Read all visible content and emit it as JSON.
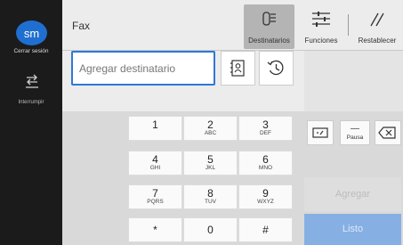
{
  "sidebar": {
    "avatar": "sm",
    "logout_label": "Cerrar sesión",
    "interrupt_label": "Interrumpir"
  },
  "header": {
    "title": "Fax",
    "destinations_label": "Destinatarios",
    "functions_label": "Funciones",
    "reset_label": "Restablecer"
  },
  "address": {
    "placeholder": "Agregar destinatario"
  },
  "keypad": [
    {
      "num": "1",
      "letters": ""
    },
    {
      "num": "2",
      "letters": "ABC"
    },
    {
      "num": "3",
      "letters": "DEF"
    },
    {
      "num": "4",
      "letters": "GHI"
    },
    {
      "num": "5",
      "letters": "JKL"
    },
    {
      "num": "6",
      "letters": "MNO"
    },
    {
      "num": "7",
      "letters": "PQRS"
    },
    {
      "num": "8",
      "letters": "TUV"
    },
    {
      "num": "9",
      "letters": "WXYZ"
    },
    {
      "num": "*",
      "letters": ""
    },
    {
      "num": "0",
      "letters": ""
    },
    {
      "num": "#",
      "letters": ""
    }
  ],
  "side_controls": {
    "pause_label": "Pausa",
    "add_label": "Agregar",
    "done_label": "Listo"
  },
  "colors": {
    "accent": "#2e78d4",
    "done_disabled": "#86b0e4",
    "sidebar_bg": "#1b1b1b"
  }
}
